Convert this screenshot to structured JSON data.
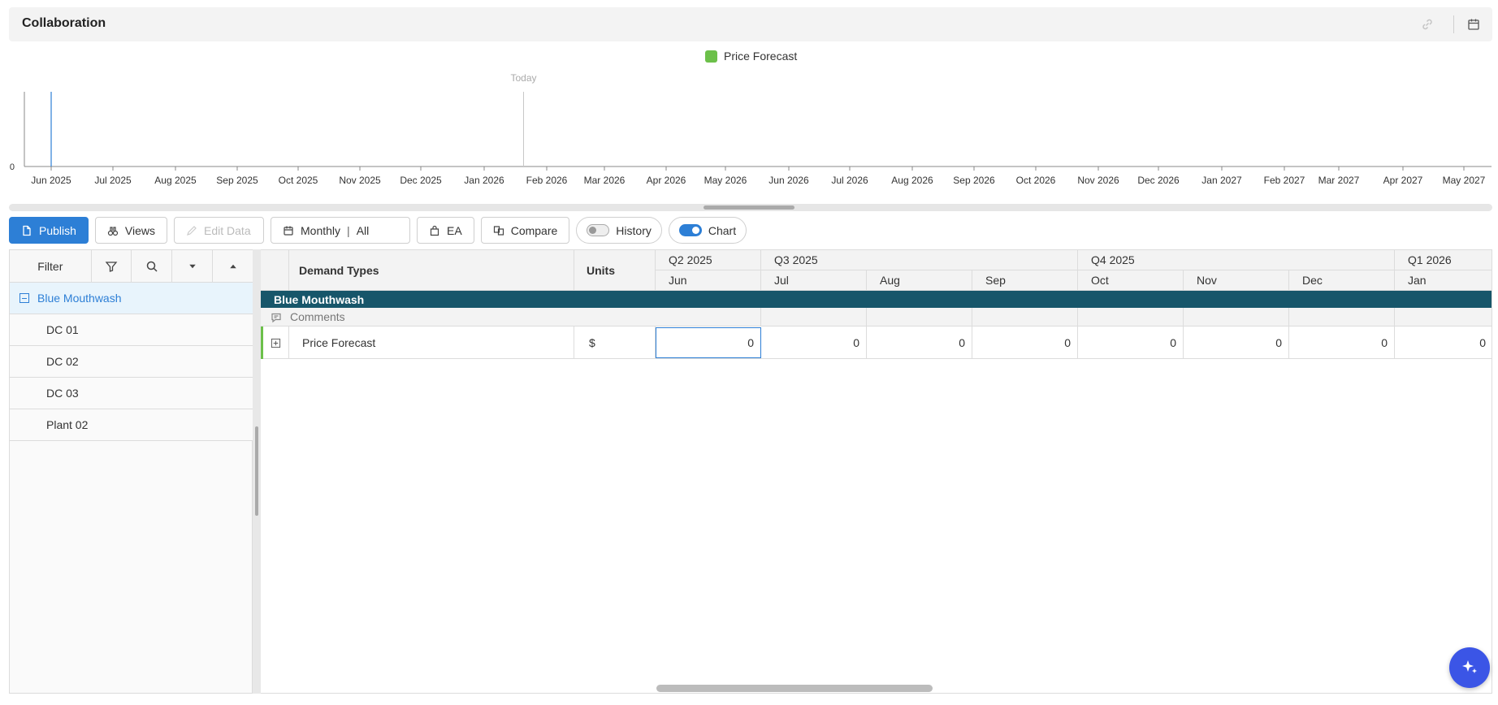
{
  "header": {
    "title": "Collaboration",
    "link_icon": "link-icon",
    "calendar_icon": "calendar-icon"
  },
  "legend": {
    "label": "Price Forecast",
    "color": "#6cc04a"
  },
  "chart_data": {
    "type": "line",
    "series": [
      {
        "name": "Price Forecast",
        "values": [
          0
        ]
      }
    ],
    "x": [
      "Jun 2025",
      "Jul 2025",
      "Aug 2025",
      "Sep 2025",
      "Oct 2025",
      "Nov 2025",
      "Dec 2025",
      "Jan 2026",
      "Feb 2026",
      "Mar 2026",
      "Apr 2026",
      "May 2026",
      "Jun 2026",
      "Jul 2026",
      "Aug 2026",
      "Sep 2026",
      "Oct 2026",
      "Nov 2026",
      "Dec 2026",
      "Jan 2027",
      "Feb 2027",
      "Mar 2027",
      "Apr 2027",
      "May 2027"
    ],
    "y_ticks": [
      "0"
    ],
    "today_label": "Today",
    "today_position": "Jan 2026",
    "grid": false,
    "legend_placement": "top-center"
  },
  "toolbar": {
    "publish": "Publish",
    "views": "Views",
    "edit_data": "Edit Data",
    "period": "Monthly",
    "period_sep": "|",
    "period_scope": "All",
    "ea": "EA",
    "compare": "Compare",
    "history": "History",
    "chart": "Chart",
    "history_on": false,
    "chart_on": true
  },
  "left_panel": {
    "filter_label": "Filter",
    "items": [
      {
        "label": "Blue Mouthwash",
        "selected": true
      },
      {
        "label": "DC 01"
      },
      {
        "label": "DC 02"
      },
      {
        "label": "DC 03"
      },
      {
        "label": "Plant 02"
      }
    ]
  },
  "grid": {
    "col_demand": "Demand Types",
    "col_units": "Units",
    "quarters": [
      "Q2 2025",
      "Q3 2025",
      "Q4 2025",
      "Q1 2026"
    ],
    "months": [
      "Jun",
      "Jul",
      "Aug",
      "Sep",
      "Oct",
      "Nov",
      "Dec",
      "Jan"
    ],
    "group": "Blue Mouthwash",
    "comments": "Comments",
    "row": {
      "label": "Price Forecast",
      "units": "$",
      "values": [
        "0",
        "0",
        "0",
        "0",
        "0",
        "0",
        "0",
        "0"
      ]
    }
  },
  "colors": {
    "accent": "#2d7fd6",
    "group_bar": "#17566a",
    "fab": "#3b55e6"
  }
}
